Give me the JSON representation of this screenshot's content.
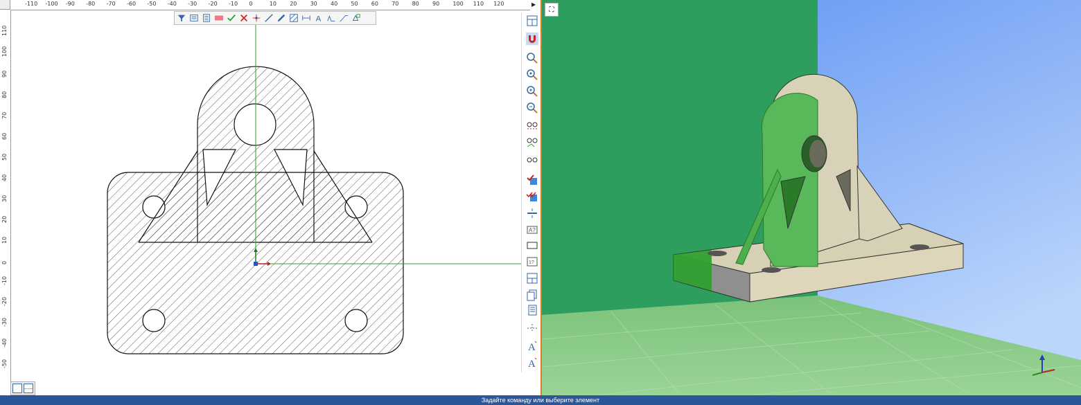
{
  "status_bar": {
    "text": "Задайте команду или выберите элемент"
  },
  "ruler": {
    "horizontal_labels": [
      "-110",
      "-100",
      "-90",
      "-80",
      "-70",
      "-60",
      "-50",
      "-40",
      "-30",
      "-20",
      "-10",
      "0",
      "10",
      "20",
      "30",
      "40",
      "50",
      "60",
      "70",
      "80",
      "90",
      "100",
      "110",
      "120"
    ],
    "vertical_labels": [
      "110",
      "100",
      "90",
      "80",
      "70",
      "60",
      "50",
      "40",
      "30",
      "20",
      "10",
      "0",
      "-10",
      "-20",
      "-30",
      "-40",
      "-50"
    ]
  },
  "top_toolbar": {
    "icons": [
      "filter-icon",
      "filter-layers-icon",
      "filter-list-icon",
      "color-swatch-icon",
      "select-check-icon",
      "deselect-icon",
      "point-icon",
      "line-icon",
      "pencil-icon",
      "hatch-icon",
      "dimension-icon",
      "text-icon",
      "roughness-icon",
      "leader-icon",
      "attach-icon"
    ]
  },
  "right_toolbar": {
    "icons": [
      "window-layout-icon",
      "snap-magnet-icon",
      "zoom-window-icon",
      "zoom-extents-icon",
      "zoom-in-icon",
      "zoom-prev-icon",
      "view-points-icon",
      "view-angles-icon",
      "view-edit-icon",
      "check-model-icon",
      "check-all-icon",
      "divider-icon",
      "text-box-icon",
      "rectangle-icon",
      "frame-icon",
      "table-icon",
      "layers-icon",
      "list-icon",
      "tolerance-icon",
      "text-style-a-icon",
      "text-style-b-icon"
    ]
  },
  "viewport": {
    "colors": {
      "sky_top": "#5a8ff2",
      "sky_bottom": "#bcd6fb",
      "wall": "#2e9e5e",
      "floor": "#93cf8f",
      "part": "#d8d2b8",
      "part_green": "#58b85a"
    }
  },
  "axes": {
    "z": "Z",
    "x": "X",
    "y": "Y"
  }
}
